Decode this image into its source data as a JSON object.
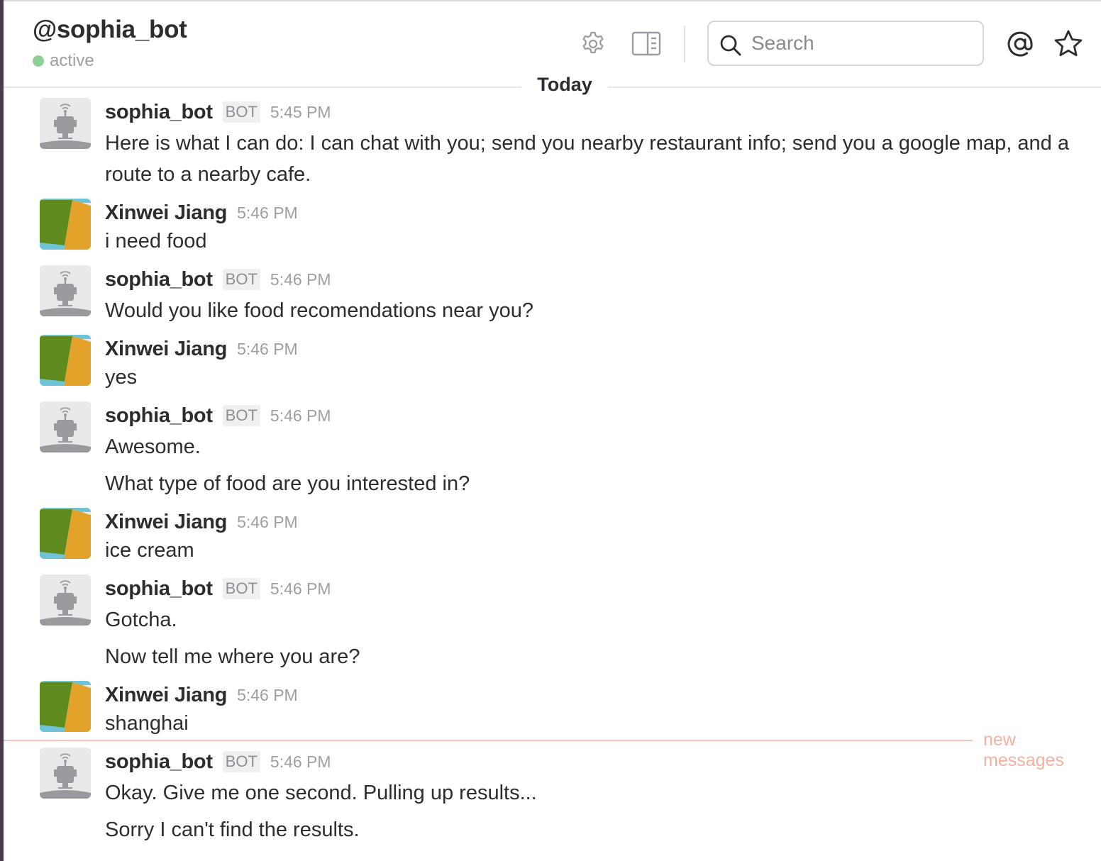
{
  "header": {
    "channel_title": "@sophia_bot",
    "presence": "active",
    "search_placeholder": "Search",
    "icons": [
      "gear-icon",
      "sidebar-toggle-icon",
      "search-icon",
      "at-sign-icon",
      "star-icon"
    ]
  },
  "day_divider": "Today",
  "new_messages_label": "new messages",
  "colors": {
    "presence": "#8dd294",
    "text": "#2c2d30",
    "muted": "#9e9ea6",
    "new_messages": "#f7b0a0",
    "left_edge": "#4d394b"
  },
  "messages": [
    {
      "sender": "sophia_bot",
      "badge": "BOT",
      "time": "5:45 PM",
      "lines": [
        "Here is what I can do: I can chat with you; send you nearby restaurant info; send you a google map, and a route to a nearby cafe."
      ]
    },
    {
      "sender": "Xinwei Jiang",
      "time": "5:46 PM",
      "lines": [
        "i need food"
      ]
    },
    {
      "sender": "sophia_bot",
      "badge": "BOT",
      "time": "5:46 PM",
      "lines": [
        "Would you like food recomendations near you?"
      ]
    },
    {
      "sender": "Xinwei Jiang",
      "time": "5:46 PM",
      "lines": [
        "yes"
      ]
    },
    {
      "sender": "sophia_bot",
      "badge": "BOT",
      "time": "5:46 PM",
      "lines": [
        "Awesome.",
        "What type of food are you interested in?"
      ]
    },
    {
      "sender": "Xinwei Jiang",
      "time": "5:46 PM",
      "lines": [
        "ice cream"
      ]
    },
    {
      "sender": "sophia_bot",
      "badge": "BOT",
      "time": "5:46 PM",
      "lines": [
        "Gotcha.",
        "Now tell me where you are?"
      ]
    },
    {
      "sender": "Xinwei Jiang",
      "time": "5:46 PM",
      "lines": [
        "shanghai"
      ]
    },
    {
      "sender": "sophia_bot",
      "badge": "BOT",
      "time": "5:46 PM",
      "lines": [
        "Okay. Give me one second. Pulling up results...",
        "Sorry I can't find the results."
      ]
    }
  ]
}
